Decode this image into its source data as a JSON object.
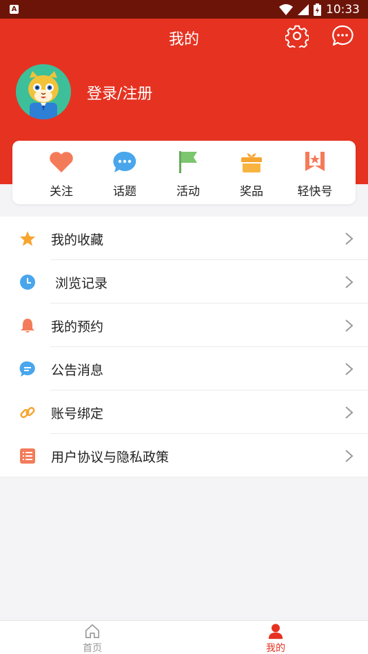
{
  "status_bar": {
    "time": "10:33",
    "app_badge": "A"
  },
  "header": {
    "title": "我的",
    "login_text": "登录/注册"
  },
  "shortcuts": [
    {
      "label": "关注",
      "icon": "heart-icon",
      "color": "#f47b59"
    },
    {
      "label": "话题",
      "icon": "chat-bubble-icon",
      "color": "#4aa6ec"
    },
    {
      "label": "活动",
      "icon": "flag-icon",
      "color": "#7cc66e"
    },
    {
      "label": "奖品",
      "icon": "gift-icon",
      "color": "#f7a531"
    },
    {
      "label": "轻快号",
      "icon": "bookmark-star-icon",
      "color": "#f47b59"
    }
  ],
  "menu": [
    {
      "label": "我的收藏",
      "icon": "star-icon",
      "color": "#f7a531"
    },
    {
      "label": "浏览记录",
      "icon": "clock-icon",
      "color": "#4aa6ec"
    },
    {
      "label": "我的预约",
      "icon": "bell-icon",
      "color": "#f47b59"
    },
    {
      "label": "公告消息",
      "icon": "message-icon",
      "color": "#4aa6ec"
    },
    {
      "label": "账号绑定",
      "icon": "link-icon",
      "color": "#f7a531"
    },
    {
      "label": "用户协议与隐私政策",
      "icon": "list-icon",
      "color": "#f47b59"
    }
  ],
  "tabbar": {
    "home_label": "首页",
    "mine_label": "我的",
    "active_color": "#e63221"
  },
  "colors": {
    "brand": "#e63221",
    "status_bar": "#6d1408"
  }
}
